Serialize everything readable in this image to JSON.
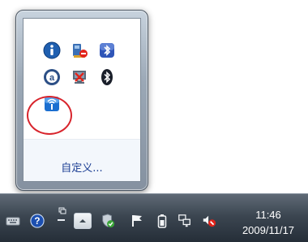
{
  "popup": {
    "icons": [
      {
        "name": "info-icon"
      },
      {
        "name": "pc-warning-icon"
      },
      {
        "name": "bluetooth-blue-icon"
      },
      {
        "name": "update-a-icon"
      },
      {
        "name": "network-disconnected-icon"
      },
      {
        "name": "bluetooth-icon"
      },
      {
        "name": "wireless-signal-icon"
      }
    ],
    "customize_label": "自定义..."
  },
  "taskbar": {
    "icons": [
      {
        "name": "keyboard-icon"
      },
      {
        "name": "help-icon"
      },
      {
        "name": "language-bar-icon"
      },
      {
        "name": "show-hidden-icons-icon"
      },
      {
        "name": "security-shield-icon"
      },
      {
        "name": "action-center-flag-icon"
      },
      {
        "name": "battery-icon"
      },
      {
        "name": "network-icon"
      },
      {
        "name": "volume-muted-icon"
      }
    ],
    "clock": {
      "time": "11:46",
      "date": "2009/11/17"
    }
  }
}
